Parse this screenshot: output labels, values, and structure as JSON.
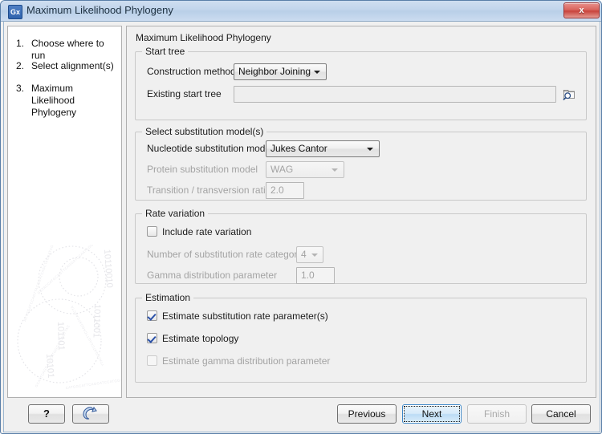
{
  "window": {
    "title": "Maximum Likelihood Phylogeny",
    "app_icon": "Gx",
    "close_icon": "x",
    "accent_color": "#2f63ad",
    "titlebar_color": "#c2d5ec"
  },
  "sidebar": {
    "steps": [
      {
        "number": "1.",
        "label": "Choose where to run"
      },
      {
        "number": "2.",
        "label": "Select alignment(s)"
      },
      {
        "number": "3.",
        "label": "Maximum Likelihood Phylogeny"
      }
    ],
    "watermark_icon": "binary-helix-watermark"
  },
  "main": {
    "heading": "Maximum Likelihood Phylogeny",
    "groups": {
      "start_tree": {
        "title": "Start tree",
        "construction_method_label": "Construction method",
        "construction_method_value": "Neighbor Joining",
        "existing_start_tree_label": "Existing start tree",
        "existing_start_tree_value": "",
        "browse_icon": "folder-search-icon"
      },
      "substitution": {
        "title": "Select substitution model(s)",
        "nucleotide_label": "Nucleotide substitution model",
        "nucleotide_value": "Jukes Cantor",
        "protein_label": "Protein substitution model",
        "protein_value": "WAG",
        "ratio_label": "Transition / transversion ratio",
        "ratio_value": "2.0"
      },
      "rate_variation": {
        "title": "Rate variation",
        "include_label": "Include rate variation",
        "include_checked": false,
        "categories_label": "Number of substitution rate categories",
        "categories_value": "4",
        "gamma_label": "Gamma distribution parameter",
        "gamma_value": "1.0"
      },
      "estimation": {
        "title": "Estimation",
        "items": [
          {
            "label": "Estimate substitution rate parameter(s)",
            "checked": true,
            "enabled": true
          },
          {
            "label": "Estimate topology",
            "checked": true,
            "enabled": true
          },
          {
            "label": "Estimate gamma distribution parameter",
            "checked": false,
            "enabled": false
          }
        ]
      }
    }
  },
  "footer": {
    "help_label": "?",
    "help_icon": "question-mark-icon",
    "wand_icon": "magic-wand-icon",
    "previous_label": "Previous",
    "next_label": "Next",
    "finish_label": "Finish",
    "cancel_label": "Cancel",
    "focused_button": "Next",
    "disabled_button": "Finish"
  }
}
